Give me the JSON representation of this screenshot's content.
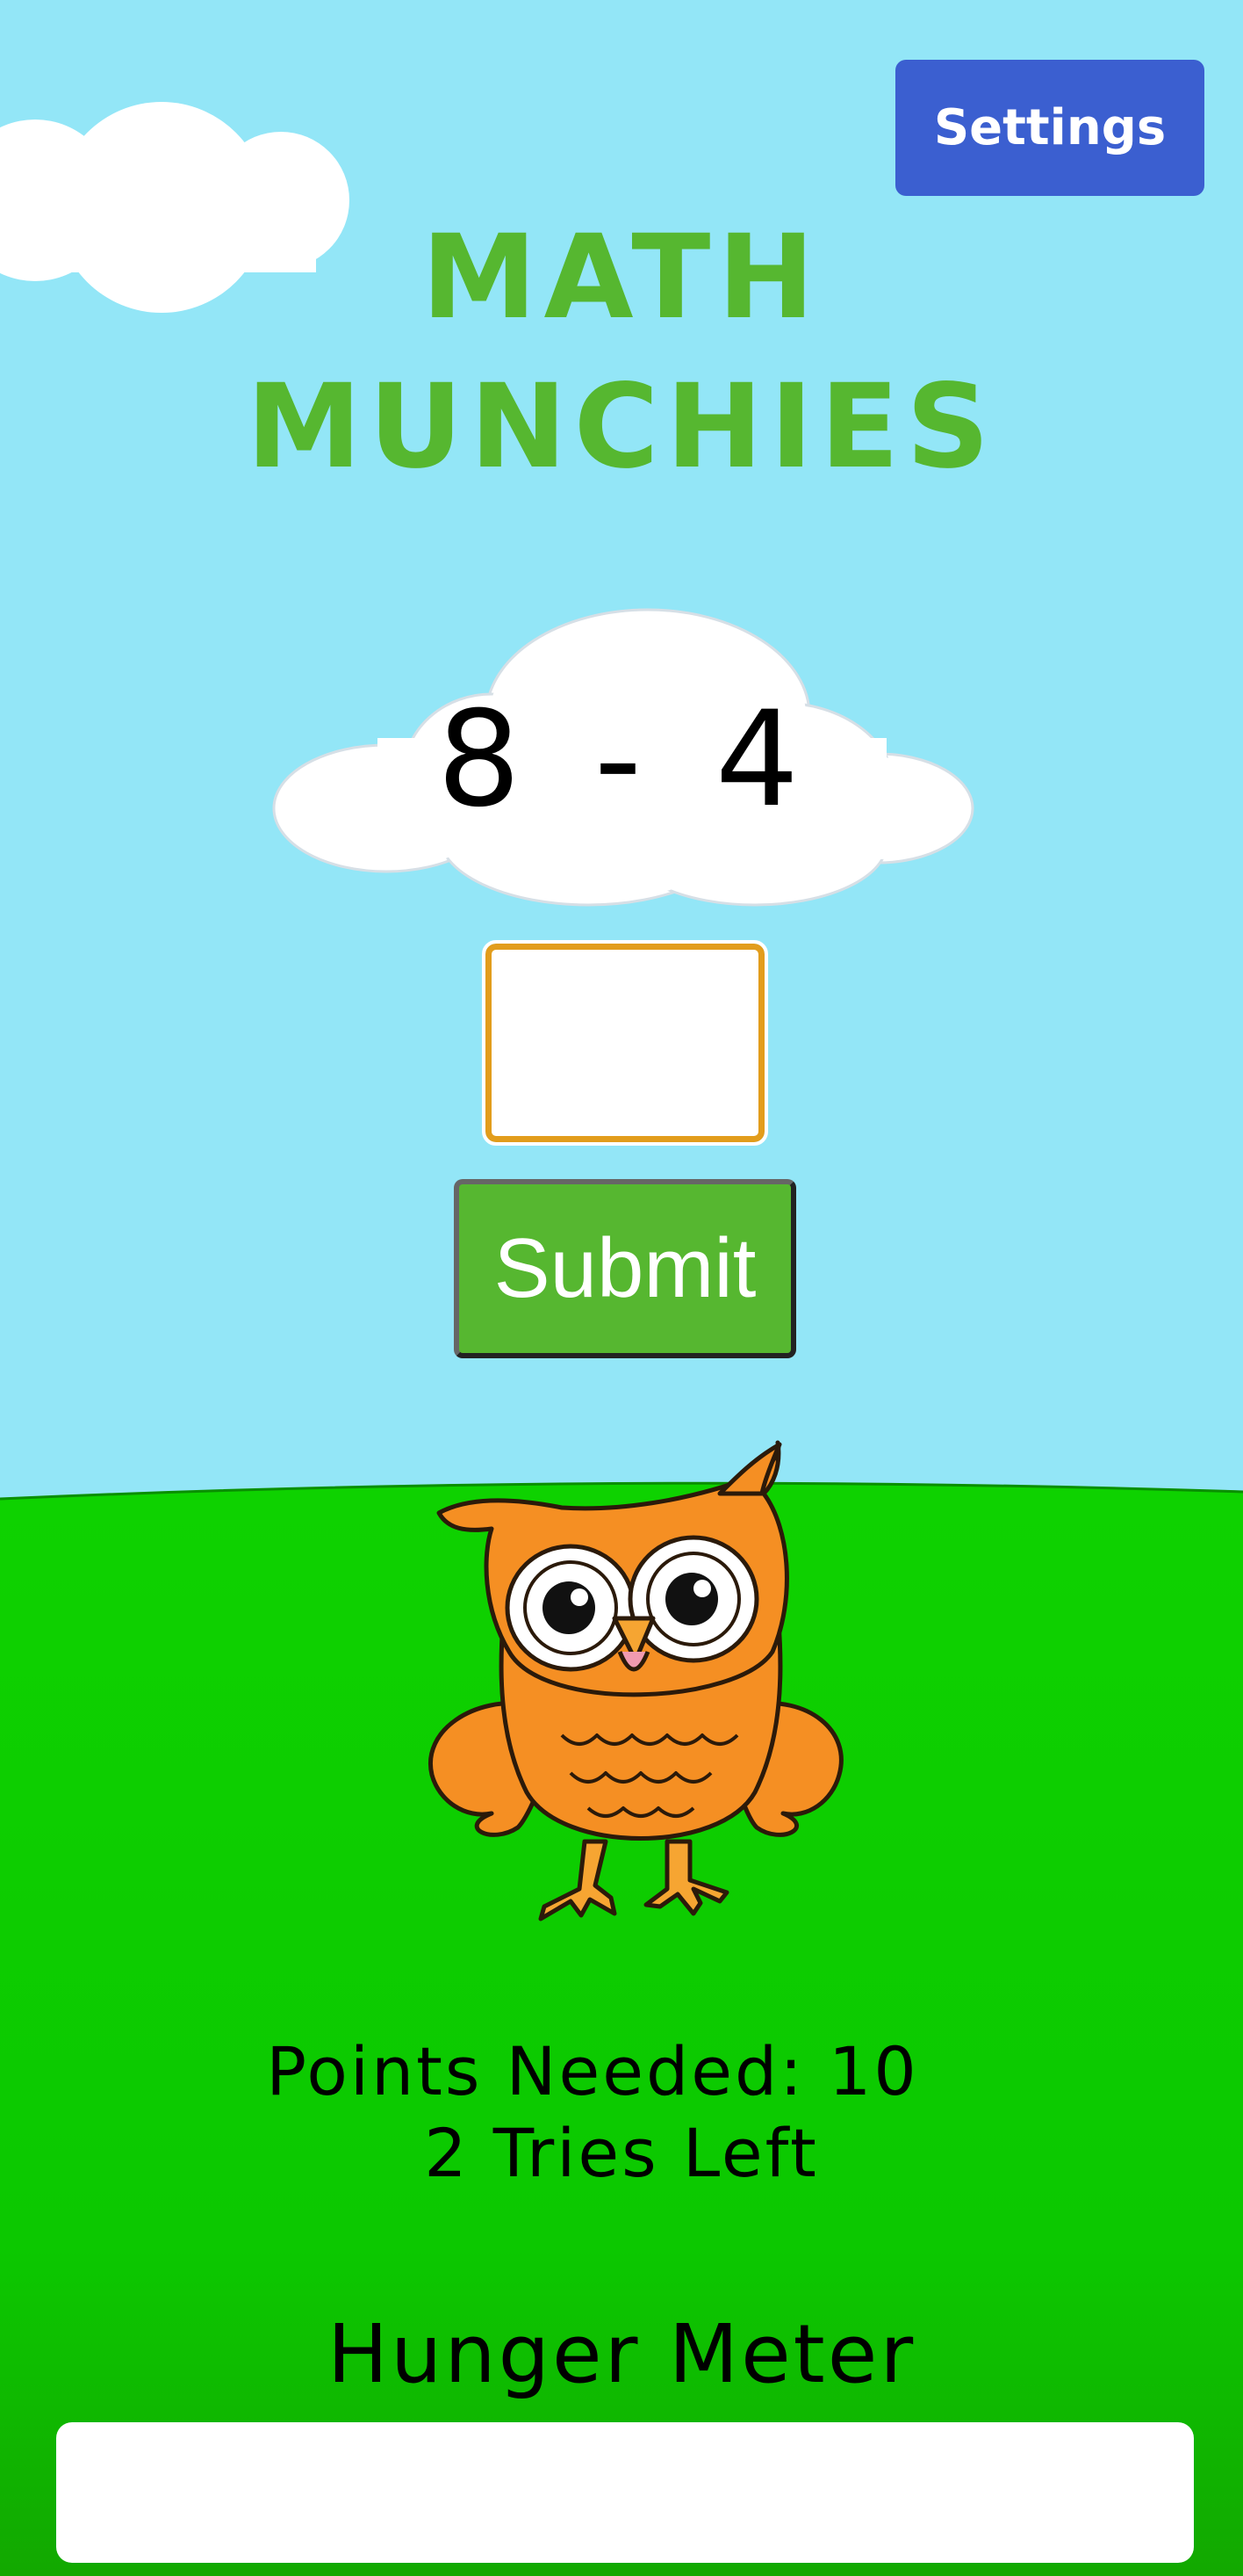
{
  "header": {
    "settings_label": "Settings"
  },
  "title": {
    "line1": "MATH",
    "line2": "MUNCHIES"
  },
  "problem": {
    "text": "8 - 4"
  },
  "answer": {
    "value": "",
    "placeholder": ""
  },
  "submit_label": "Submit",
  "status": {
    "points_needed": "Points Needed: 10",
    "tries_left": "2 Tries Left"
  },
  "hunger_meter": {
    "label": "Hunger Meter",
    "level": 0
  },
  "colors": {
    "sky": "#93e6f7",
    "grass": "#0ed200",
    "title_green": "#56b730",
    "settings_blue": "#3b5fd0",
    "input_border": "#e29d1c",
    "owl_orange": "#f58f23"
  },
  "icons": {
    "mascot": "owl-icon",
    "cloud": "cloud-icon"
  }
}
